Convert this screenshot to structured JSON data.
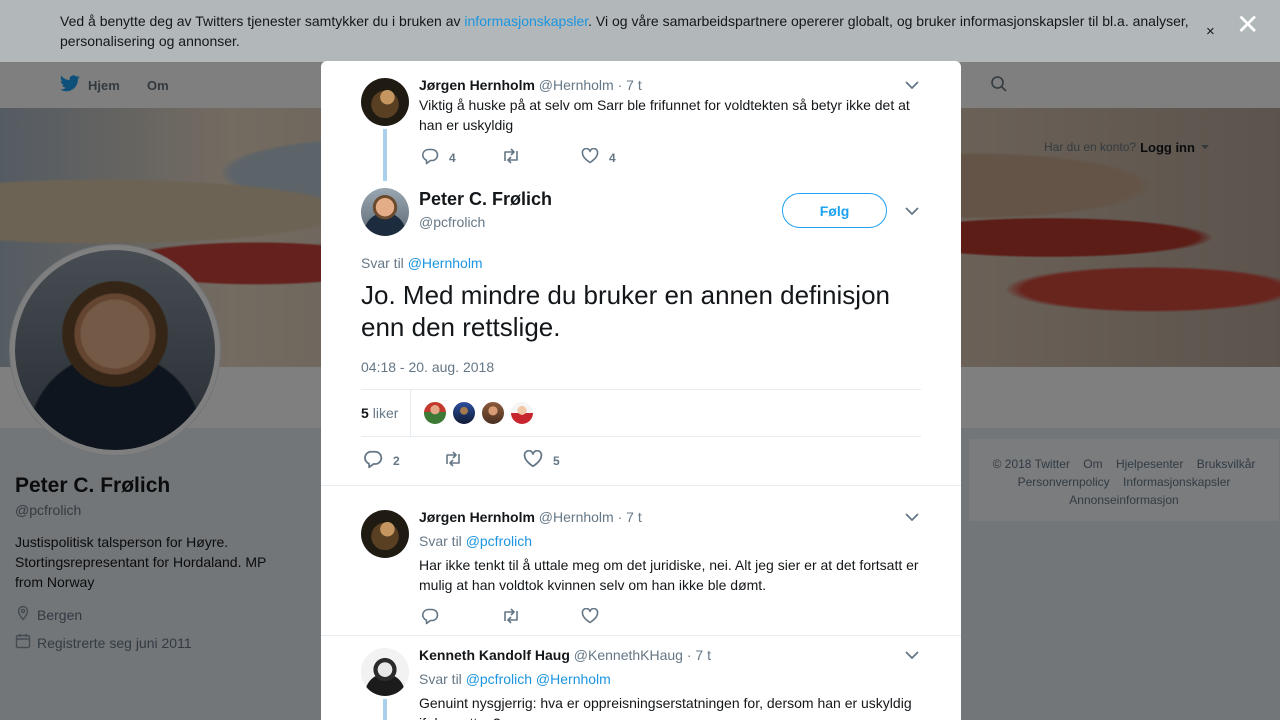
{
  "cookie_banner": {
    "text_before": "Ved å benytte deg av Twitters tjenester samtykker du i bruken av ",
    "link": "informasjonskapsler",
    "text_after": ". Vi og våre samarbeidspartnere opererer globalt, og bruker informasjonskapsler til bl.a. analyser, personalisering og annonser.",
    "close": "×"
  },
  "overlay_close": "✕",
  "nav": {
    "home": "Hjem",
    "about": "Om",
    "account_prompt": "Har du en konto?",
    "login": "Logg inn"
  },
  "profile": {
    "name": "Peter C. Frølich",
    "handle": "@pcfrolich",
    "bio": "Justispolitisk talsperson for Høyre. Stortingsrepresentant for Hordaland. MP from Norway",
    "location": "Bergen",
    "joined": "Registrerte seg juni 2011"
  },
  "footer": {
    "items": [
      "© 2018 Twitter",
      "Om",
      "Hjelpesenter",
      "Bruksvilkår",
      "Personvernpolicy",
      "Informasjonskapsler",
      "Annonseinformasjon"
    ]
  },
  "modal": {
    "parent_tweet": {
      "name": "Jørgen Hernholm",
      "handle": "@Hernholm",
      "time": "· 7 t",
      "text": "Viktig å huske på at selv om Sarr ble frifunnet for voldtekten så betyr ikke det at han er uskyldig",
      "replies": "4",
      "retweets": "",
      "likes": "4"
    },
    "main_tweet": {
      "name": "Peter C. Frølich",
      "handle": "@pcfrolich",
      "follow": "Følg",
      "reply_prefix": "Svar til",
      "reply_to": "@Hernholm",
      "text": "Jo. Med mindre du bruker en annen definisjon enn den rettslige.",
      "timestamp": "04:18 - 20. aug. 2018",
      "likes_count": "5",
      "likes_label": "liker",
      "replies": "2",
      "retweets": "",
      "likes": "5"
    },
    "replies": [
      {
        "name": "Jørgen Hernholm",
        "handle": "@Hernholm",
        "time": "· 7 t",
        "reply_prefix": "Svar til",
        "reply_to": "@pcfrolich",
        "text": "Har ikke tenkt til å uttale meg om det juridiske, nei. Alt jeg sier er at det fortsatt er mulig at han voldtok kvinnen selv om han ikke ble dømt."
      },
      {
        "name": "Kenneth Kandolf Haug",
        "handle": "@KennethKHaug",
        "time": "· 7 t",
        "reply_prefix": "Svar til",
        "reply_to": "@pcfrolich @Hernholm",
        "text": "Genuint nysgjerrig: hva er oppreisningserstatningen for, dersom han er uskyldig ifølge retten?"
      }
    ]
  }
}
